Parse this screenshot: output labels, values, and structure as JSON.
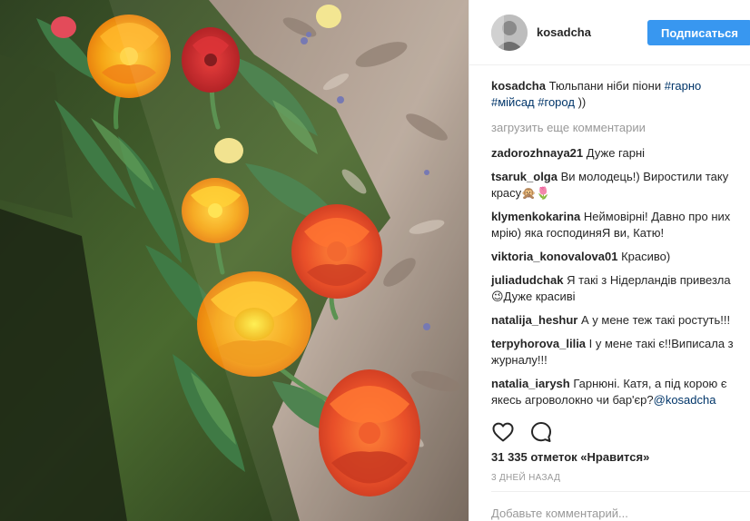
{
  "post": {
    "username": "kosadcha",
    "follow_label": "Подписаться",
    "caption": {
      "author": "kosadcha",
      "text": " Тюльпани ніби піони ",
      "tags": [
        "#гарно",
        "#мійсад",
        "#город"
      ],
      "suffix": " ))"
    },
    "load_more_label": "загрузить еще комментарии",
    "comments": [
      {
        "author": "zadorozhnaya21",
        "text": " Дуже гарні"
      },
      {
        "author": "tsaruk_olga",
        "text": " Ви молодець!) Виростили таку красу🙊🌷"
      },
      {
        "author": "klymenkokarina",
        "text": " Неймовірні! Давно про них мрію) яка господиняЯ ви, Катю!"
      },
      {
        "author": "viktoria_konovalova01",
        "text": " Красиво)"
      },
      {
        "author": "juliadudchak",
        "text": " Я такі з Нідерландів привезла😉Дуже красиві"
      },
      {
        "author": "natalija_heshur",
        "text": " А у мене теж такі ростуть!!!"
      },
      {
        "author": "terpyhorova_lilia",
        "text": " І у мене такі є!!Виписала з журналу!!!"
      },
      {
        "author": "natalia_iarysh",
        "text": " Гарнюні. Катя, а під корою є якесь агроволокно чи бар'єр?",
        "mention": "@kosadcha"
      }
    ],
    "actions": {
      "like_icon": "heart-icon",
      "comment_icon": "comment-bubble-icon"
    },
    "likes_label": "31 335 отметок «Нравится»",
    "time_label": "3 ДНЕЙ НАЗАД",
    "add_comment_placeholder": "Добавьте комментарий...",
    "colors": {
      "accent": "#3897f0",
      "tag": "#003569",
      "muted": "#999999"
    }
  }
}
